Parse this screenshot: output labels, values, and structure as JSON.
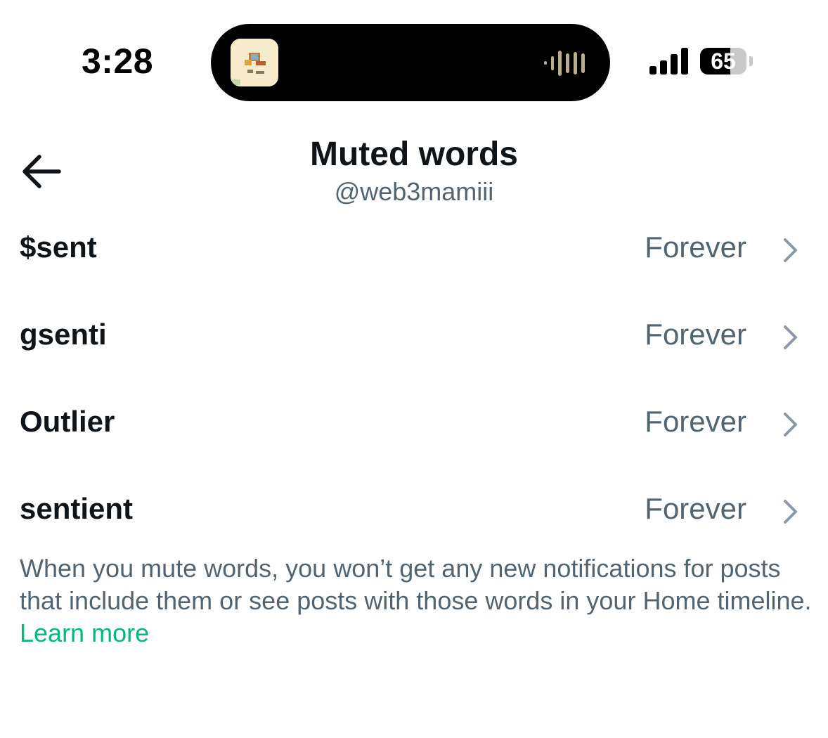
{
  "status_bar": {
    "time": "3:28",
    "battery": "65",
    "battery_level": 0.65,
    "icons": [
      "now-playing-artwork",
      "audio-waveform-icon",
      "cellular-signal-icon",
      "battery-icon"
    ]
  },
  "header": {
    "title": "Muted words",
    "subtitle": "@web3mamiii",
    "back_icon": "arrow-left-icon"
  },
  "muted_words": [
    {
      "word": "$sent",
      "duration": "Forever"
    },
    {
      "word": "gsenti",
      "duration": "Forever"
    },
    {
      "word": "Outlier",
      "duration": "Forever"
    },
    {
      "word": "sentient",
      "duration": "Forever"
    }
  ],
  "footer": {
    "text": "When you mute words, you won’t get any new notifications for posts that include them or see posts with those words in your Home timeline. ",
    "link": "Learn more"
  },
  "colors": {
    "primary_text": "#0f1419",
    "secondary_text": "#536471",
    "link": "#00ba7c",
    "chevron": "#8b98a5"
  }
}
